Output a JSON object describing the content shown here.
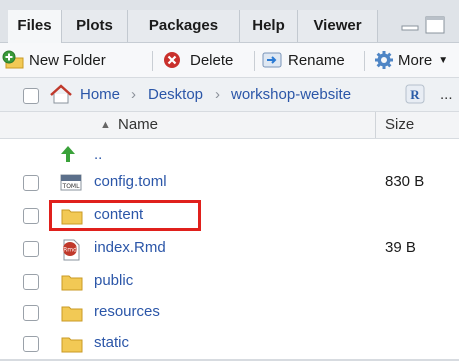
{
  "tabs": [
    {
      "label": "Files",
      "active": true
    },
    {
      "label": "Plots",
      "active": false
    },
    {
      "label": "Packages",
      "active": false
    },
    {
      "label": "Help",
      "active": false
    },
    {
      "label": "Viewer",
      "active": false
    }
  ],
  "toolbar": {
    "new_folder": "New Folder",
    "delete": "Delete",
    "rename": "Rename",
    "more": "More"
  },
  "breadcrumb": {
    "items": [
      "Home",
      "Desktop",
      "workshop-website"
    ],
    "overflow": "..."
  },
  "columns": {
    "name": "Name",
    "size": "Size"
  },
  "files": [
    {
      "name": "..",
      "size": "",
      "icon": "up-arrow-icon"
    },
    {
      "name": "config.toml",
      "size": "830 B",
      "icon": "toml-file-icon"
    },
    {
      "name": "content",
      "size": "",
      "icon": "folder-icon",
      "highlighted": true
    },
    {
      "name": "index.Rmd",
      "size": "39 B",
      "icon": "rmd-file-icon"
    },
    {
      "name": "public",
      "size": "",
      "icon": "folder-icon"
    },
    {
      "name": "resources",
      "size": "",
      "icon": "folder-icon"
    },
    {
      "name": "static",
      "size": "",
      "icon": "folder-icon"
    }
  ],
  "colors": {
    "link": "#2b56a8",
    "highlight": "#e0201c",
    "folder": "#f2c955"
  }
}
